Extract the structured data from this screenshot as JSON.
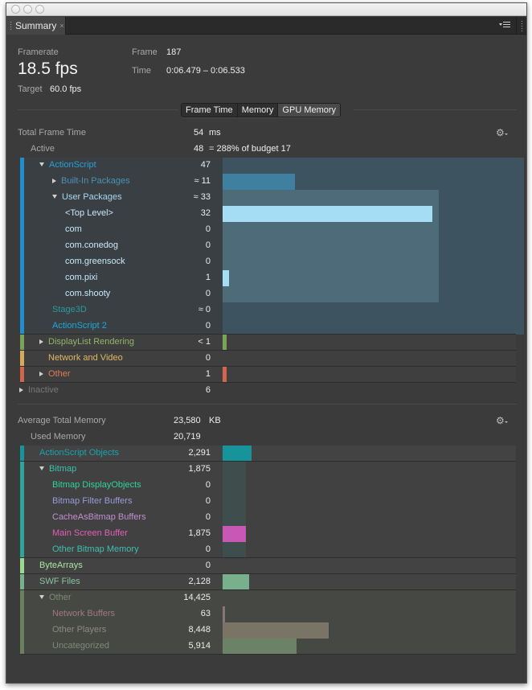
{
  "window": {
    "tab_title": "Summary",
    "tab_close": "×"
  },
  "header": {
    "framerate_label": "Framerate",
    "framerate_value": "18.5 fps",
    "target_label": "Target",
    "target_value": "60.0 fps",
    "frame_label": "Frame",
    "frame_value": "187",
    "time_label": "Time",
    "time_value": "0:06.479 – 0:06.533"
  },
  "view_tabs": [
    {
      "label": "Frame Time",
      "selected": false
    },
    {
      "label": "Memory",
      "selected": false
    },
    {
      "label": "GPU Memory",
      "selected": true
    }
  ],
  "frame_time": {
    "total_label": "Total Frame Time",
    "total_value": "54",
    "total_unit": "ms",
    "active_label": "Active",
    "active_value": "48",
    "active_budget_text": "=  288%  of budget 17",
    "scale_max": 33,
    "rows": [
      {
        "label": "ActionScript",
        "value": "47",
        "num": 47,
        "indent": 1,
        "expander": "down",
        "color": "#2a9fd6",
        "stripe": "#1f8fd0"
      },
      {
        "label": "Built-In Packages",
        "value": "≈ 11",
        "num": 11,
        "indent": 2,
        "expander": "right",
        "color": "#4d90b5",
        "bar": "#3f7fa0"
      },
      {
        "label": "User Packages",
        "value": "≈ 33",
        "num": 33,
        "indent": 2,
        "expander": "down",
        "color": "#a9d7f0"
      },
      {
        "label": "<Top Level>",
        "value": "32",
        "num": 32,
        "indent": 3,
        "color": "#c9e8fb",
        "bar": "#a5ddf5"
      },
      {
        "label": "com",
        "value": "0",
        "num": 0,
        "indent": 3,
        "color": "#c9e8fb"
      },
      {
        "label": "com.conedog",
        "value": "0",
        "num": 0,
        "indent": 3,
        "color": "#c9e8fb"
      },
      {
        "label": "com.greensock",
        "value": "0",
        "num": 0,
        "indent": 3,
        "color": "#c9e8fb"
      },
      {
        "label": "com.pixi",
        "value": "1",
        "num": 1,
        "indent": 3,
        "color": "#c9e8fb",
        "bar": "#a5ddf5"
      },
      {
        "label": "com.shooty",
        "value": "0",
        "num": 0,
        "indent": 3,
        "color": "#c9e8fb"
      },
      {
        "label": "Stage3D",
        "value": "≈ 0",
        "num": 0,
        "indent": 2,
        "color": "#2a9a9a"
      },
      {
        "label": "ActionScript 2",
        "value": "0",
        "num": 0,
        "indent": 2,
        "color": "#1fa8d8"
      }
    ],
    "categories": [
      {
        "label": "DisplayList Rendering",
        "value": "< 1",
        "num": 0.4,
        "expander": "right",
        "color": "#93b56b",
        "stripe": "#7aa35a",
        "bar": "#7aa35a"
      },
      {
        "label": "Network and Video",
        "value": "0",
        "num": 0,
        "expander": "none",
        "color": "#e0b866",
        "stripe": "#d8a85a"
      },
      {
        "label": "Other",
        "value": "1",
        "num": 1,
        "expander": "right",
        "color": "#e07a5a",
        "stripe": "#d0664a",
        "bar": "#d0664a"
      }
    ],
    "inactive_label": "Inactive",
    "inactive_value": "6"
  },
  "memory": {
    "total_label": "Average Total Memory",
    "total_value": "23,580",
    "total_unit": "KB",
    "used_label": "Used Memory",
    "used_value": "20,719",
    "scale_max": 14425,
    "rows": [
      {
        "label": "ActionScript Objects",
        "value": "2,291",
        "num": 2291,
        "indent": 1,
        "color": "#1aa3b0",
        "stripe": "#17939c",
        "bar": "#17939c",
        "group": "as"
      },
      {
        "label": "Bitmap",
        "value": "1,875",
        "num": 1875,
        "indent": 1,
        "expander": "down",
        "color": "#3cbfb0",
        "stripe": "#2fa59a",
        "group": "bitmap"
      },
      {
        "label": "Bitmap DisplayObjects",
        "value": "0",
        "num": 0,
        "indent": 2,
        "color": "#2fd49a",
        "group": "bitmap"
      },
      {
        "label": "Bitmap Filter Buffers",
        "value": "0",
        "num": 0,
        "indent": 2,
        "color": "#9a9ad8",
        "group": "bitmap"
      },
      {
        "label": "CacheAsBitmap Buffers",
        "value": "0",
        "num": 0,
        "indent": 2,
        "color": "#c28fd0",
        "group": "bitmap"
      },
      {
        "label": "Main Screen Buffer",
        "value": "1,875",
        "num": 1875,
        "indent": 2,
        "color": "#e05fb8",
        "bar": "#c957b5",
        "group": "bitmap"
      },
      {
        "label": "Other Bitmap Memory",
        "value": "0",
        "num": 0,
        "indent": 2,
        "color": "#3fbfb0",
        "group": "bitmap"
      },
      {
        "label": "ByteArrays",
        "value": "0",
        "num": 0,
        "indent": 1,
        "color": "#a8e6a0",
        "stripe": "#98d890",
        "group": "ba"
      },
      {
        "label": "SWF Files",
        "value": "2,128",
        "num": 2128,
        "indent": 1,
        "color": "#88c4a0",
        "stripe": "#77b08e",
        "bar": "#78b08e",
        "group": "swf"
      },
      {
        "label": "Other",
        "value": "14,425",
        "num": 14425,
        "indent": 1,
        "expander": "down",
        "color": "#808a78",
        "stripe": "#6c8060",
        "group": "other"
      },
      {
        "label": "Network Buffers",
        "value": "63",
        "num": 63,
        "indent": 2,
        "color": "#a07880",
        "bar": "#8a7478",
        "group": "other"
      },
      {
        "label": "Other Players",
        "value": "8,448",
        "num": 8448,
        "indent": 2,
        "color": "#8e8a80",
        "bar": "#7a7466",
        "group": "other"
      },
      {
        "label": "Uncategorized",
        "value": "5,914",
        "num": 5914,
        "indent": 2,
        "color": "#7f8a78",
        "bar": "#6c8266",
        "group": "other"
      }
    ]
  },
  "icons": {
    "gear": "⚙",
    "menu": "panel-menu-icon"
  }
}
